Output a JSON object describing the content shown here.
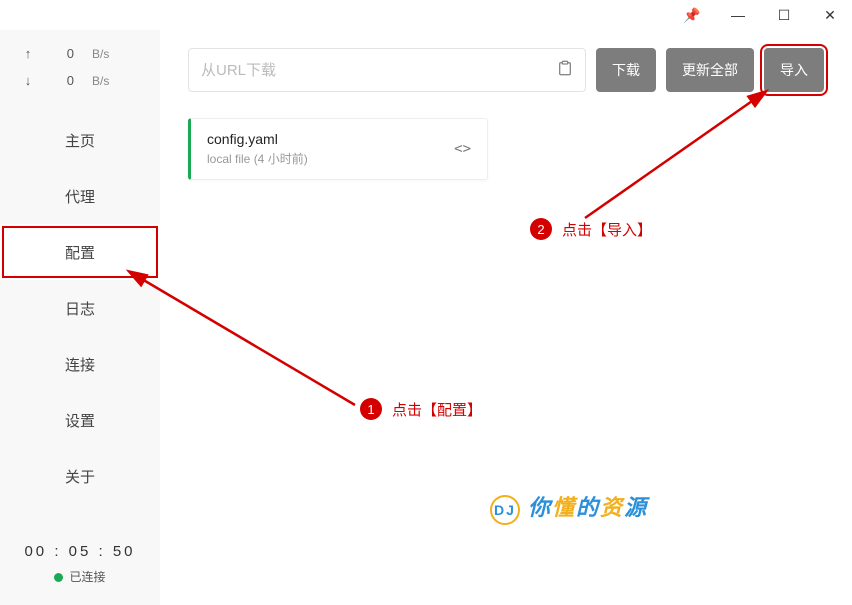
{
  "titlebar": {
    "pin": "📌",
    "min": "—",
    "max": "☐",
    "close": "✕"
  },
  "traffic": {
    "up": {
      "arrow": "↑",
      "value": "0",
      "unit": "B/s"
    },
    "down": {
      "arrow": "↓",
      "value": "0",
      "unit": "B/s"
    }
  },
  "nav": {
    "home": "主页",
    "proxy": "代理",
    "profiles": "配置",
    "logs": "日志",
    "connections": "连接",
    "settings": "设置",
    "about": "关于"
  },
  "status": {
    "time": "00 : 05 : 50",
    "text": "已连接"
  },
  "urlbar": {
    "placeholder": "从URL下载",
    "download": "下载",
    "updateAll": "更新全部",
    "import": "导入"
  },
  "config": {
    "name": "config.yaml",
    "sub": "local file (4 小时前)",
    "codeIcon": "<>"
  },
  "annotations": {
    "step1": {
      "num": "1",
      "text": "点击【配置】"
    },
    "step2": {
      "num": "2",
      "text": "点击【导入】"
    }
  },
  "watermark": {
    "logo": "DJ",
    "chars": [
      "你",
      "懂",
      "的",
      "资",
      "源"
    ],
    "colors": [
      "#2a90d9",
      "#f2b01e",
      "#2a90d9",
      "#f2b01e",
      "#2a90d9"
    ]
  }
}
